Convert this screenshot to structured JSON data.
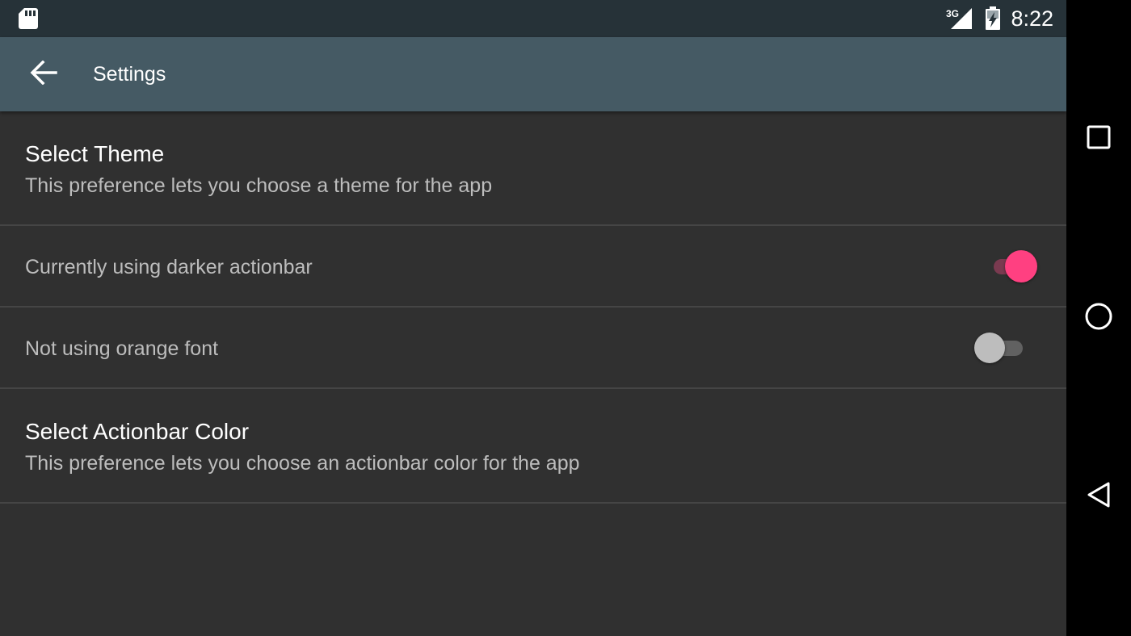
{
  "status_bar": {
    "time": "8:22",
    "network": "3G",
    "icons": [
      "sd-card-icon",
      "signal-3g-icon",
      "battery-charging-icon"
    ]
  },
  "app_bar": {
    "title": "Settings",
    "back_icon": "arrow-back-icon"
  },
  "preferences": [
    {
      "title": "Select Theme",
      "summary": "This preference lets you choose a theme for the app"
    },
    {
      "label": "Currently using darker actionbar",
      "switch_on": true
    },
    {
      "label": "Not using orange font",
      "switch_on": false
    },
    {
      "title": "Select Actionbar Color",
      "summary": "This preference lets you choose an actionbar color for the app"
    }
  ],
  "nav_bar": {
    "buttons": [
      "recents-icon",
      "home-icon",
      "back-icon"
    ]
  },
  "colors": {
    "status_bar": "#263238",
    "app_bar": "#455a64",
    "background": "#303030",
    "accent": "#ff4081",
    "switch_on_track": "#7a3a50",
    "switch_off_thumb": "#bdbdbd",
    "switch_off_track": "#616161"
  }
}
